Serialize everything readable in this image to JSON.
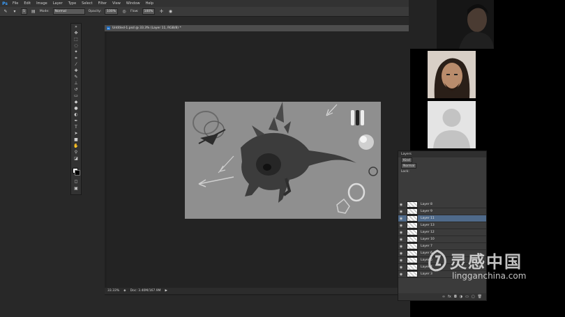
{
  "menubar": {
    "logo": "Ps",
    "items": [
      "File",
      "Edit",
      "Image",
      "Layer",
      "Type",
      "Select",
      "Filter",
      "View",
      "Window",
      "Help"
    ]
  },
  "options": {
    "brush_size": "5",
    "mode_label": "Mode:",
    "mode_value": "Normal",
    "opacity_label": "Opacity:",
    "opacity_value": "100%",
    "flow_label": "Flow:",
    "flow_value": "100%"
  },
  "document": {
    "tab_title": "Untitled-1.psd @ 33.3% (Layer 11, RGB/8) *",
    "zoom": "33.33%",
    "doc_size": "Doc: 3.40M/167.9M"
  },
  "layers_panel": {
    "title": "Layers",
    "kind_label": "Kind",
    "blend_mode": "Normal",
    "lock_label": "Lock:",
    "layers": [
      {
        "name": "Layer 8",
        "selected": false
      },
      {
        "name": "Layer 9",
        "selected": false
      },
      {
        "name": "Layer 11",
        "selected": true
      },
      {
        "name": "Layer 13",
        "selected": false
      },
      {
        "name": "Layer 12",
        "selected": false
      },
      {
        "name": "Layer 10",
        "selected": false
      },
      {
        "name": "Layer 7",
        "selected": false
      },
      {
        "name": "Layer 6",
        "selected": false
      },
      {
        "name": "Layer 5",
        "selected": false
      },
      {
        "name": "Layer 4",
        "selected": false
      },
      {
        "name": "Layer 3",
        "selected": false
      }
    ]
  },
  "watermark": {
    "chinese": "灵感中国",
    "url": "lingganchina.com"
  },
  "colors": {
    "ui_dark": "#282828",
    "canvas_gray": "#8f8f8f",
    "selected_layer": "#4f6a8a",
    "ps_blue": "#3aa0ff"
  }
}
